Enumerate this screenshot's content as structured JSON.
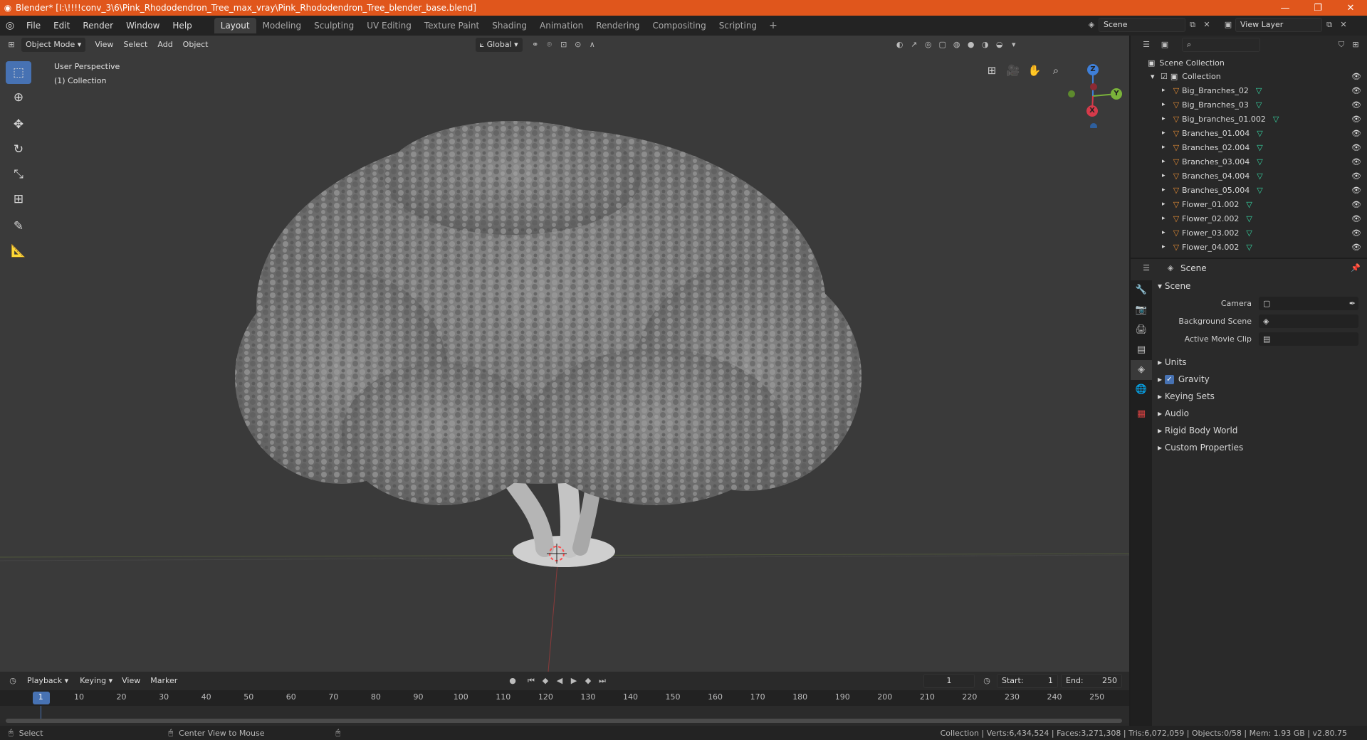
{
  "titlebar": {
    "title": "Blender* [I:\\!!!!conv_3\\6\\Pink_Rhododendron_Tree_max_vray\\Pink_Rhododendron_Tree_blender_base.blend]",
    "minimize": "—",
    "maximize": "❐",
    "close": "✕"
  },
  "menubar": {
    "items": [
      "File",
      "Edit",
      "Render",
      "Window",
      "Help"
    ],
    "workspaces": [
      "Layout",
      "Modeling",
      "Sculpting",
      "UV Editing",
      "Texture Paint",
      "Shading",
      "Animation",
      "Rendering",
      "Compositing",
      "Scripting"
    ],
    "active_workspace": "Layout",
    "add_workspace": "+",
    "scene": "Scene",
    "view_layer": "View Layer"
  },
  "viewport": {
    "mode": "Object Mode",
    "menus": [
      "View",
      "Select",
      "Add",
      "Object"
    ],
    "orientation": "Global",
    "perspective_label": "User Perspective",
    "collection_label": "(1) Collection",
    "gizmo": {
      "x": "X",
      "y": "Y",
      "z": "Z"
    }
  },
  "timeline": {
    "menus": [
      "Playback",
      "Keying",
      "View",
      "Marker"
    ],
    "current_frame": "1",
    "start_label": "Start:",
    "start": "1",
    "end_label": "End:",
    "end": "250",
    "ticks": [
      "1",
      "10",
      "20",
      "30",
      "40",
      "50",
      "60",
      "70",
      "80",
      "90",
      "100",
      "110",
      "120",
      "130",
      "140",
      "150",
      "160",
      "170",
      "180",
      "190",
      "200",
      "210",
      "220",
      "230",
      "240",
      "250"
    ]
  },
  "statusbar": {
    "select": "Select",
    "center_view": "Center View to Mouse",
    "stats": "Collection | Verts:6,434,524 | Faces:3,271,308 | Tris:6,072,059 | Objects:0/58 | Mem: 1.93 GB | v2.80.75"
  },
  "outliner": {
    "scene_collection": "Scene Collection",
    "collection": "Collection",
    "items": [
      "Big_Branches_02",
      "Big_Branches_03",
      "Big_branches_01.002",
      "Branches_01.004",
      "Branches_02.004",
      "Branches_03.004",
      "Branches_04.004",
      "Branches_05.004",
      "Flower_01.002",
      "Flower_02.002",
      "Flower_03.002",
      "Flower_04.002"
    ]
  },
  "properties": {
    "context": "Scene",
    "panel_title": "Scene",
    "camera_label": "Camera",
    "background_scene_label": "Background Scene",
    "active_movie_clip_label": "Active Movie Clip",
    "subpanels": [
      "Units",
      "Gravity",
      "Keying Sets",
      "Audio",
      "Rigid Body World",
      "Custom Properties"
    ],
    "gravity_checked": true
  },
  "colors": {
    "titlebar": "#e0561c",
    "accent": "#4772b3",
    "object_icon": "#e38b35",
    "mesh_icon": "#36d7a4"
  }
}
